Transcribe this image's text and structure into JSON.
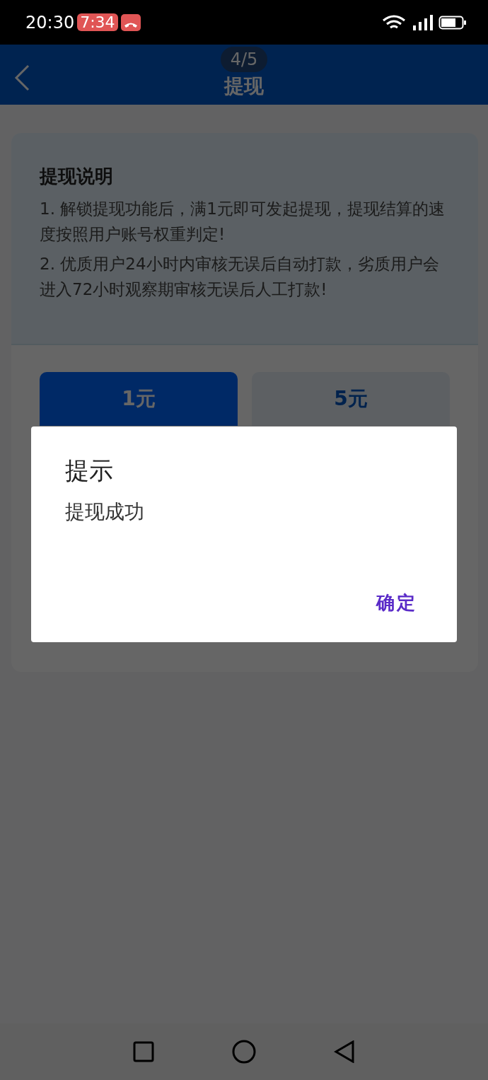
{
  "status_bar": {
    "time": "20:30",
    "badge_time": "7:34"
  },
  "header": {
    "title": "提现",
    "page_counter": "4/5"
  },
  "notice": {
    "title": "提现说明",
    "items": [
      "1. 解锁提现功能后，满1元即可发起提现，提现结算的速度按照用户账号权重判定!",
      "2. 优质用户24小时内审核无误后自动打款，劣质用户会进入72小时观察期审核无误后人工打款!"
    ]
  },
  "amounts": [
    {
      "label": "1元",
      "selected": true
    },
    {
      "label": "5元",
      "selected": false
    }
  ],
  "dialog": {
    "title": "提示",
    "message": "提现成功",
    "confirm": "确定"
  }
}
